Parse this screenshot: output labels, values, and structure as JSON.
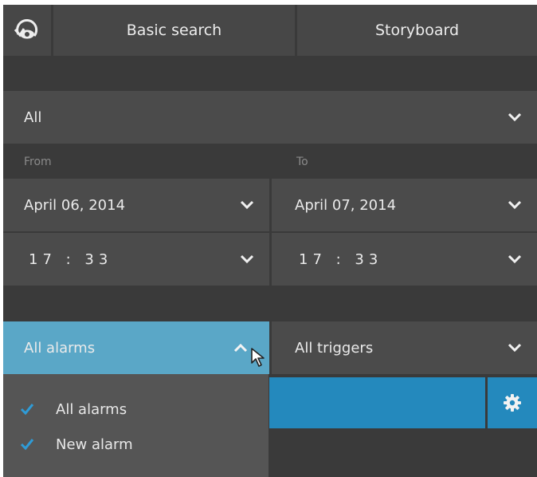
{
  "colors": {
    "accent": "#5aa7c7",
    "progress": "#2489bd",
    "check": "#2f9bd6"
  },
  "tabs": {
    "basic_search": "Basic search",
    "storyboard": "Storyboard"
  },
  "filter": {
    "selected": "All"
  },
  "range": {
    "from_label": "From",
    "to_label": "To",
    "from_date": "April 06, 2014",
    "to_date": "April 07, 2014",
    "from_time": "17 : 33",
    "to_time": "17 : 33"
  },
  "alarms": {
    "selected": "All alarms",
    "triggers": "All triggers",
    "options": [
      {
        "label": "All alarms",
        "checked": true
      },
      {
        "label": "New alarm",
        "checked": true
      }
    ]
  }
}
